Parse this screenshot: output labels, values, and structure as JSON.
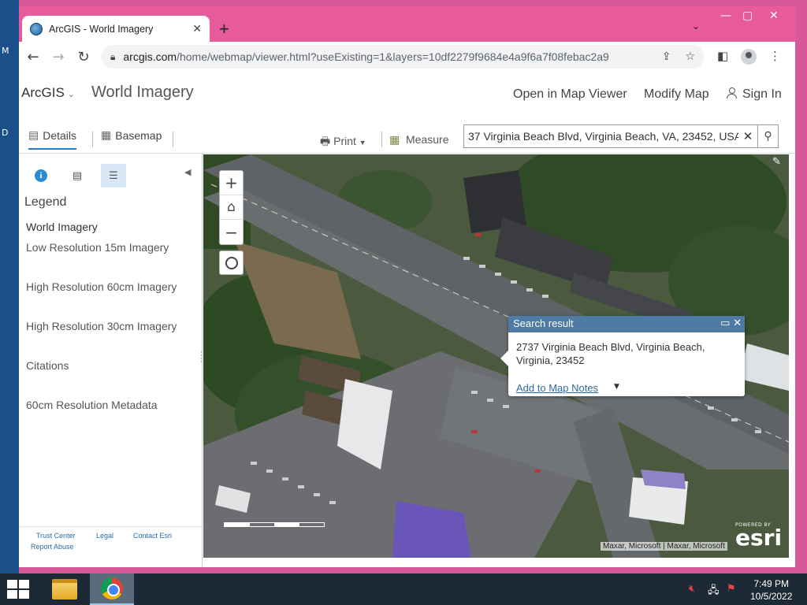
{
  "desktop": {
    "left_glyphs": [
      "M",
      "D"
    ]
  },
  "browser": {
    "tab_title": "ArcGIS - World Imagery",
    "tab_close": "✕",
    "new_tab": "+",
    "tab_menu": "⌄",
    "url_host": "arcgis.com",
    "url_path": "/home/webmap/viewer.html?useExisting=1&layers=10df2279f9684e4a9f6a7f08febac2a9",
    "back": "←",
    "forward": "→",
    "reload": "↻"
  },
  "app": {
    "brand": "ArcGIS",
    "title": "World Imagery",
    "open_map_viewer": "Open in Map Viewer",
    "modify_map": "Modify Map",
    "sign_in": "Sign In"
  },
  "subbar": {
    "details": "Details",
    "basemap": "Basemap",
    "print": "Print",
    "measure": "Measure",
    "search_value": "37 Virginia Beach Blvd, Virginia Beach, VA, 23452, USA"
  },
  "legend": {
    "title": "Legend",
    "layer": "World Imagery",
    "items": [
      "Low Resolution 15m Imagery",
      "High Resolution 60cm Imagery",
      "High Resolution 30cm Imagery",
      "Citations",
      "60cm Resolution Metadata"
    ]
  },
  "footer": {
    "trust": "Trust Center",
    "legal": "Legal",
    "contact": "Contact Esri",
    "report": "Report Abuse"
  },
  "popup": {
    "title": "Search result",
    "line1": "2737 Virginia Beach Blvd, Virginia Beach,",
    "line2": "Virginia, 23452",
    "link": "Add to Map Notes"
  },
  "map": {
    "attribution": "Maxar, Microsoft | Maxar, Microsoft",
    "powered": "POWERED BY",
    "esri": "esri"
  },
  "taskbar": {
    "time": "7:49 PM",
    "date": "10/5/2022"
  }
}
